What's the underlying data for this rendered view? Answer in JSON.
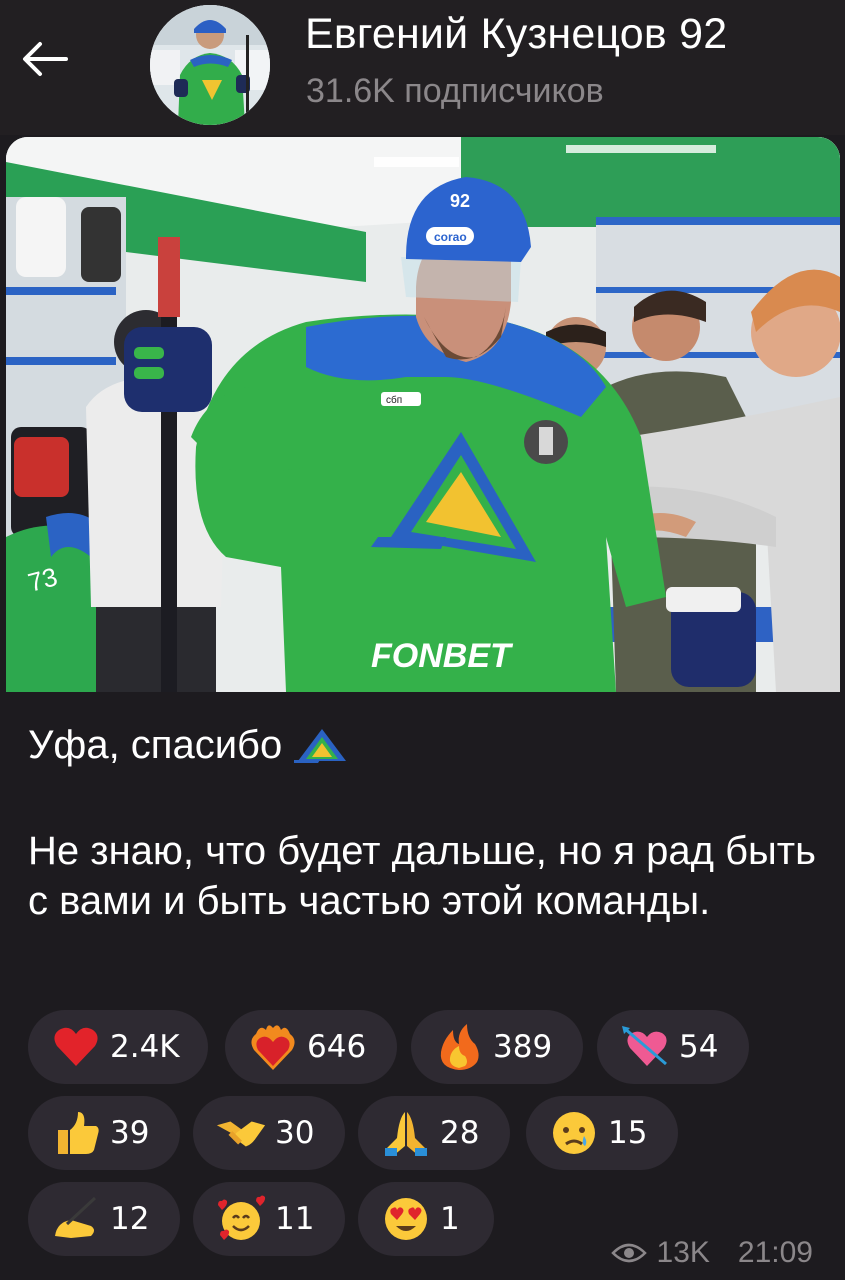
{
  "header": {
    "title": "Евгений Кузнецов 92",
    "subscribers": "31.6K подписчиков"
  },
  "post": {
    "line1": "Уфа, спасибо",
    "paragraph": "Не знаю, что будет дальше, но я рад быть с вами и быть частью этой команды.",
    "photo_texts": {
      "sponsor": "FONBET",
      "sponsor2": "сбп",
      "helmet_brand": "corao",
      "helmet_number": "92",
      "jersey_number": "73"
    }
  },
  "reactions": [
    {
      "icon": "red-heart",
      "count": "2.4K"
    },
    {
      "icon": "heart-on-fire",
      "count": "646"
    },
    {
      "icon": "fire",
      "count": "389"
    },
    {
      "icon": "heart-with-arrow",
      "count": "54"
    },
    {
      "icon": "thumbs-up",
      "count": "39"
    },
    {
      "icon": "handshake",
      "count": "30"
    },
    {
      "icon": "folded-hands",
      "count": "28"
    },
    {
      "icon": "crying-face",
      "count": "15"
    },
    {
      "icon": "writing-hand",
      "count": "12"
    },
    {
      "icon": "smiling-face-with-hearts",
      "count": "11"
    },
    {
      "icon": "heart-eyes",
      "count": "1"
    }
  ],
  "meta": {
    "views": "13K",
    "time": "21:09"
  },
  "colors": {
    "header_bg": "#221f22",
    "post_bg": "#1d1b1f",
    "reaction_bg": "#2e2a32",
    "muted": "#8b878a",
    "jersey_green": "#3bb54a",
    "jersey_blue": "#2a67c9"
  }
}
